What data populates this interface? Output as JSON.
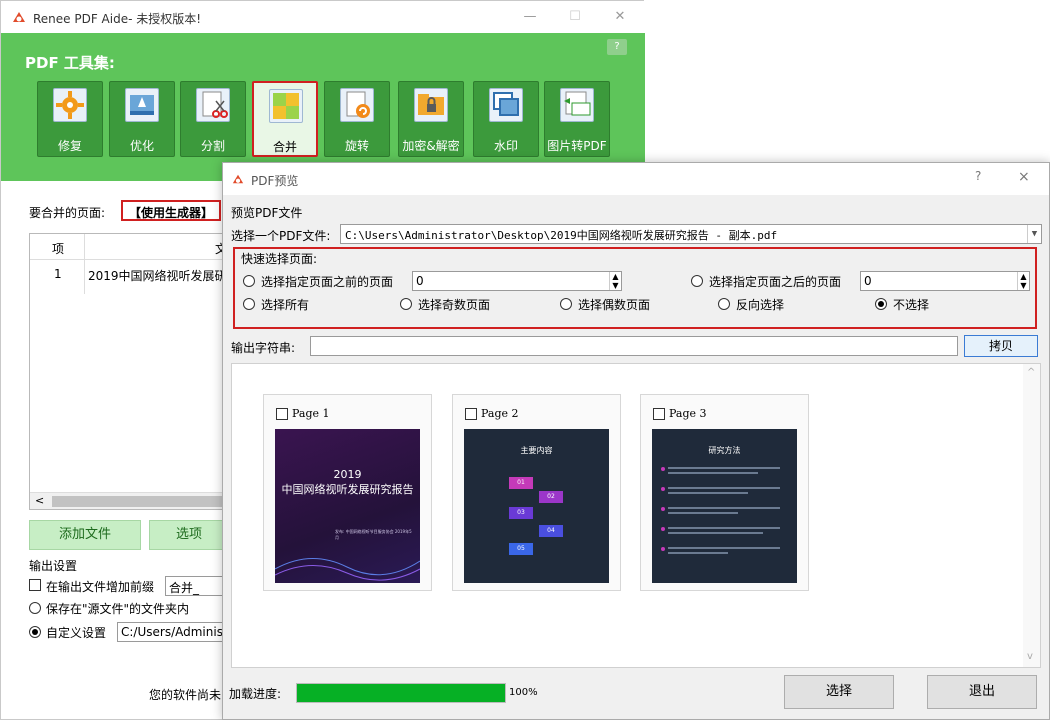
{
  "main": {
    "title": "Renee PDF Aide- 未授权版本!",
    "banner_title": "PDF 工具集:",
    "help": "?",
    "tools": [
      {
        "label": "修复",
        "icon": "gear-icon"
      },
      {
        "label": "优化",
        "icon": "rocket-icon"
      },
      {
        "label": "分割",
        "icon": "scissors-icon"
      },
      {
        "label": "合并",
        "icon": "puzzle-icon"
      },
      {
        "label": "旋转",
        "icon": "rotate-icon"
      },
      {
        "label": "加密&解密",
        "icon": "lock-folder-icon"
      },
      {
        "label": "水印",
        "icon": "watermark-icon"
      },
      {
        "label": "图片转PDF",
        "icon": "image-to-pdf-icon"
      }
    ],
    "merge_pages_label": "要合并的页面:",
    "generator_button": "【使用生成器】",
    "table": {
      "headers": [
        "项",
        "文"
      ],
      "rows": [
        [
          "1",
          "2019中国网络视听发展研"
        ]
      ]
    },
    "add_file": "添加文件",
    "options": "选项",
    "output_settings": "输出设置",
    "prefix_check": "在输出文件增加前缀",
    "prefix_value": "合并_",
    "save_source": "保存在\"源文件\"的文件夹内",
    "custom": "自定义设置",
    "custom_path": "C:/Users/Administ",
    "status": "您的软件尚未"
  },
  "dialog": {
    "title": "PDF预览",
    "help": "?",
    "close": "×",
    "preview_label": "预览PDF文件",
    "choose_label": "选择一个PDF文件:",
    "file_path": "C:\\Users\\Administrator\\Desktop\\2019中国网络视听发展研究报告 - 副本.pdf",
    "quick_caption": "快速选择页面:",
    "before_label": "选择指定页面之前的页面",
    "before_value": "0",
    "after_label": "选择指定页面之后的页面",
    "after_value": "0",
    "all": "选择所有",
    "odd": "选择奇数页面",
    "even": "选择偶数页面",
    "invert": "反向选择",
    "none": "不选择",
    "selected_option": "none",
    "output_string_label": "输出字符串:",
    "copy": "拷贝",
    "pages": [
      {
        "label": "Page 1",
        "heading": "2019\n中国网络视听发展研究报告",
        "footer": "发布: 中国网络视听节目服务协会 2019年5月"
      },
      {
        "label": "Page 2",
        "heading": "主要内容",
        "items": [
          "01",
          "02",
          "03",
          "04",
          "05"
        ]
      },
      {
        "label": "Page 3",
        "heading": "研究方法"
      }
    ],
    "progress_label": "加载进度:",
    "progress": 1.0,
    "progress_text": "100%",
    "select": "选择",
    "exit": "退出"
  }
}
